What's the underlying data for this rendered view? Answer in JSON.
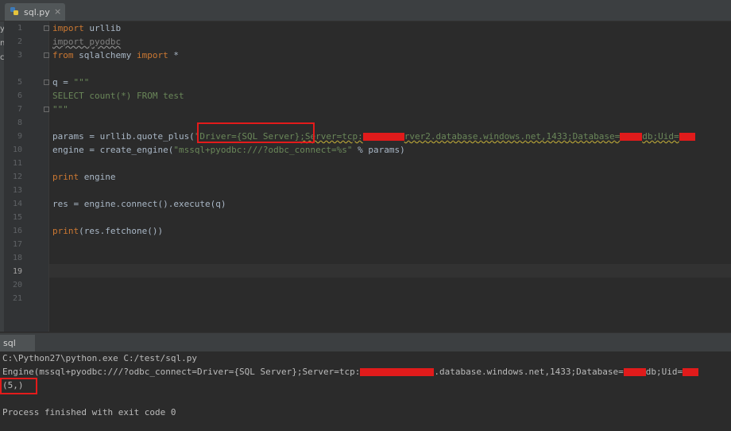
{
  "tab": {
    "filename": "sql.py",
    "close": "×"
  },
  "left_strip": [
    "y",
    "n",
    "c"
  ],
  "gutter": {
    "line_numbers": [
      "1",
      "2",
      "3",
      "4",
      "5",
      "6",
      "7",
      "8",
      "9",
      "10",
      "11",
      "12",
      "13",
      "14",
      "15",
      "16",
      "17",
      "18",
      "19",
      "20",
      "21"
    ],
    "current_line": "19"
  },
  "code": {
    "l1_kw": "import",
    "l1_id": " urllib",
    "l2": "import pyodbc",
    "l3_kw1": "from",
    "l3_id": " sqlalchemy ",
    "l3_kw2": "import",
    "l3_id2": " *",
    "l5_id": "q = ",
    "l5_str": "\"\"\"",
    "l6": "SELECT count(*) FROM test",
    "l7": "\"\"\"",
    "l9_pre": "params = urllib.quote_plus(",
    "l9_s1": "\"Driver={SQL Server}",
    "l9_s2": ";Server=tcp:",
    "l9_s3": "rver2.database.windows.net,1433;Database=",
    "l9_s4": "db;Uid=",
    "l10_pre": "engine = create_engine(",
    "l10_str": "\"mssql+pyodbc:///?odbc_connect=%s\"",
    "l10_post": " % params)",
    "l12_kw": "print",
    "l12_id": " engine",
    "l14": "res = engine.connect().execute(q)",
    "l16_kw": "print",
    "l16_id": "(res.fetchone())"
  },
  "run": {
    "tab_label": "sql"
  },
  "console": {
    "cmd": "C:\\Python27\\python.exe C:/test/sql.py",
    "engine_pre": "Engine(mssql+pyodbc:///?odbc_connect=Driver={SQL Server};Server=tcp:",
    "engine_mid": ".database.windows.net,1433;Database=",
    "engine_post": "db;Uid=",
    "result": "(5,)",
    "exit": "Process finished with exit code 0"
  },
  "colors": {
    "background": "#2b2b2b",
    "keyword": "#cc7832",
    "string": "#6a8759",
    "redaction": "#e01b1b",
    "highlight_box": "#e31b1b"
  }
}
